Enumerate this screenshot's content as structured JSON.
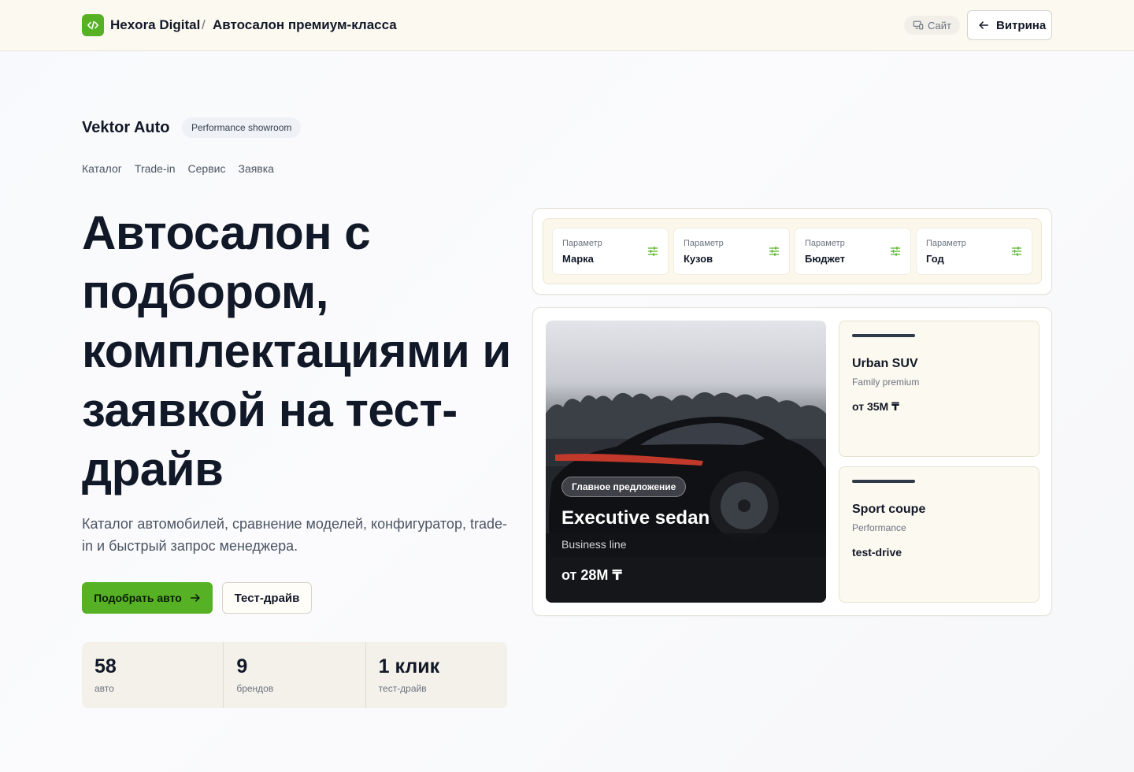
{
  "header": {
    "brand": "Hexora Digital",
    "separator": "/",
    "page_title": "Автосалон премиум-класса",
    "site_label": "Сайт",
    "showcase_label": "Витрина"
  },
  "company": {
    "name": "Vektor Auto",
    "tag": "Performance showroom"
  },
  "nav": [
    "Каталог",
    "Trade-in",
    "Сервис",
    "Заявка"
  ],
  "hero": {
    "title": "Автосалон с подбором, комплектациями и заявкой на тест-драйв",
    "subtitle": "Каталог автомобилей, сравнение моделей, конфигуратор, trade-in и быстрый запрос менеджера.",
    "primary_cta": "Подобрать авто",
    "secondary_cta": "Тест-драйв"
  },
  "stats": [
    {
      "value": "58",
      "label": "авто"
    },
    {
      "value": "9",
      "label": "брендов"
    },
    {
      "value": "1 клик",
      "label": "тест-драйв"
    }
  ],
  "filters": [
    {
      "caption": "Параметр",
      "value": "Марка"
    },
    {
      "caption": "Параметр",
      "value": "Кузов"
    },
    {
      "caption": "Параметр",
      "value": "Бюджет"
    },
    {
      "caption": "Параметр",
      "value": "Год"
    }
  ],
  "featured": {
    "badge": "Главное предложение",
    "title": "Executive sedan",
    "subtitle": "Business line",
    "price": "от 28M ₸"
  },
  "offers": [
    {
      "title": "Urban SUV",
      "subtitle": "Family premium",
      "price": "от 35M ₸"
    },
    {
      "title": "Sport coupe",
      "subtitle": "Performance",
      "price": "test-drive"
    }
  ],
  "colors": {
    "accent": "#56b224",
    "header_bg": "#fcf9f1",
    "card_cream": "#fcf9f0",
    "text_dark": "#111827",
    "bar_dark": "#2f3a4a"
  },
  "icons": {
    "brand": "code-icon",
    "site": "devices-icon",
    "showcase": "arrow-left-icon",
    "cta": "arrow-right-icon",
    "filter": "sliders-icon"
  }
}
